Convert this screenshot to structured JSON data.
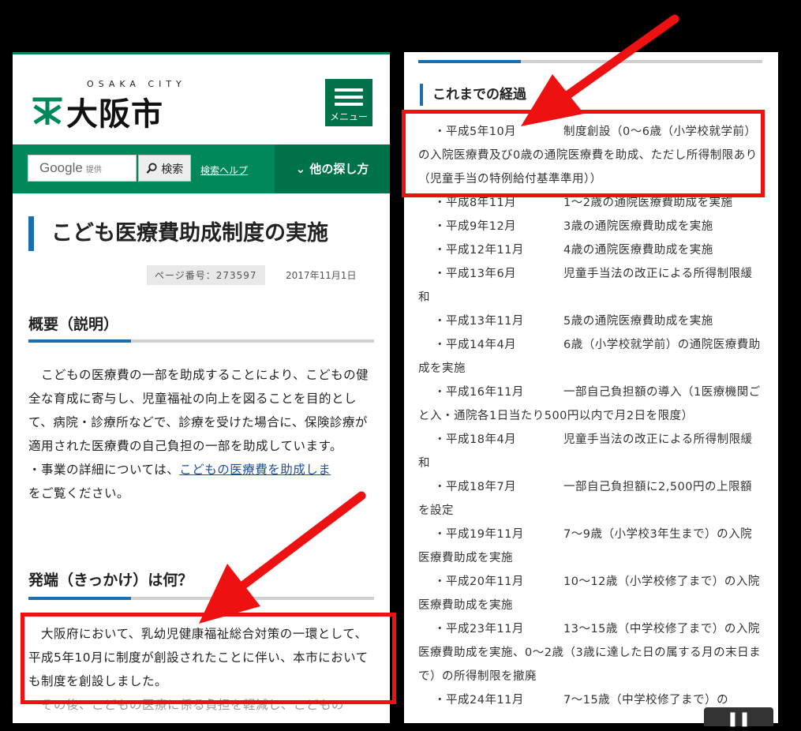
{
  "header": {
    "logo_sub": "OSAKA CITY",
    "logo_text": "大阪市",
    "menu_label": "メニュー"
  },
  "search": {
    "input_text": "Google",
    "input_provider": "提供",
    "button_label": "検索",
    "help_link": "検索ヘルプ",
    "other_search": "他の探し方"
  },
  "page": {
    "title": "こども医療費助成制度の実施",
    "page_number": "ページ番号：273597",
    "date": "2017年11月1日"
  },
  "sections": {
    "overview_heading": "概要（説明）",
    "overview_text": "　こどもの医療費の一部を助成することにより、こどもの健全な育成に寄与し、児童福祉の向上を図ることを目的として、病院・診療所などで、診療を受けた場合に、保険診療が適用された医療費の自己負担の一部を助成しています。",
    "detail_prefix": "・事業の詳細については、",
    "detail_link": "こどもの医療費を助成しま",
    "detail_suffix": "をご覧ください。",
    "origin_heading": "発端（きっかけ）は何？",
    "origin_text": "　大阪府において、乳幼児健康福祉総合対策の一環として、平成5年10月に制度が創設されたことに伴い、本市においても制度を創設しました。",
    "origin_cut": "　その後、こどもの医療に係る負担を軽減し、こどもの"
  },
  "history": {
    "heading": "これまでの経過",
    "items": [
      {
        "year": "・平成5年10月",
        "text": "制度創設（0～6歳（小学校就学前）の入院医療費及び0歳の通院医療費を助成、ただし所得制限あり（児童手当の特例給付基準準用））"
      },
      {
        "year": "・平成8年11月",
        "text": "1～2歳の通院医療費助成を実施"
      },
      {
        "year": "・平成9年12月",
        "text": "3歳の通院医療費助成を実施"
      },
      {
        "year": "・平成12年11月",
        "text": "4歳の通院医療費助成を実施"
      },
      {
        "year": "・平成13年6月",
        "text": "児童手当法の改正による所得制限緩和"
      },
      {
        "year": "・平成13年11月",
        "text": "5歳の通院医療費助成を実施"
      },
      {
        "year": "・平成14年4月",
        "text": "6歳（小学校就学前）の通院医療費助成を実施"
      },
      {
        "year": "・平成16年11月",
        "text": "一部自己負担額の導入（1医療機関ごと入・通院各1日当たり500円以内で月2日を限度）"
      },
      {
        "year": "・平成18年4月",
        "text": "児童手当法の改正による所得制限緩和"
      },
      {
        "year": "・平成18年7月",
        "text": "一部自己負担額に2,500円の上限額を設定"
      },
      {
        "year": "・平成19年11月",
        "text": "7～9歳（小学校3年生まで）の入院医療費助成を実施"
      },
      {
        "year": "・平成20年11月",
        "text": "10～12歳（小学校修了まで）の入院医療費助成を実施"
      },
      {
        "year": "・平成23年11月",
        "text": "13～15歳（中学校修了まで）の入院医療費助成を実施、0～2歳（3歳に達した日の属する月の末日まで）の所得制限を撤廃"
      },
      {
        "year": "・平成24年11月",
        "text": "7～15歳（中学校修了まで）の"
      }
    ]
  },
  "colors": {
    "brand_green": "#00875a",
    "accent_blue": "#1b6fb0",
    "annotation_red": "#e11111"
  }
}
